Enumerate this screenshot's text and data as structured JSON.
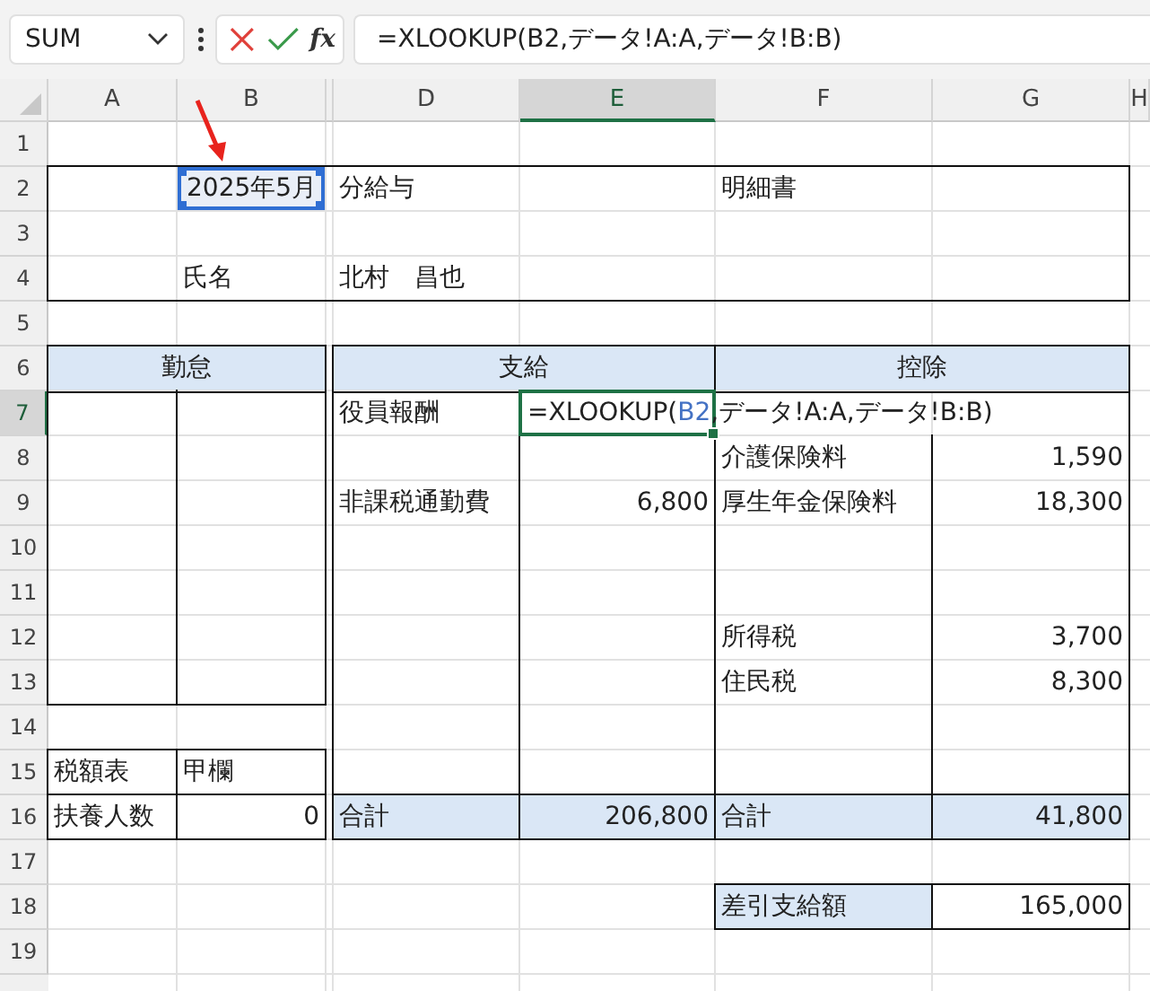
{
  "name_box": {
    "value": "SUM"
  },
  "formula_bar": {
    "function_label": "fx",
    "value": "=XLOOKUP(B2,データ!A:A,データ!B:B)"
  },
  "columns": [
    {
      "label": "A",
      "selected": false
    },
    {
      "label": "B",
      "selected": false
    },
    {
      "selected": false
    },
    {
      "label": "D",
      "selected": false
    },
    {
      "label": "E",
      "selected": true
    },
    {
      "label": "F",
      "selected": false
    },
    {
      "label": "G",
      "selected": false
    },
    {
      "label": "H",
      "selected": false
    }
  ],
  "rows": [
    {
      "label": "1",
      "selected": false
    },
    {
      "label": "2",
      "selected": false,
      "cells": [
        {},
        {
          "kind": "number",
          "text": "2025年5月",
          "selected": true
        },
        {},
        {
          "kind": "text",
          "text": "分給与"
        },
        {},
        {
          "kind": "text",
          "text": "明細書"
        }
      ]
    },
    {
      "label": "3",
      "selected": false
    },
    {
      "label": "4",
      "selected": false,
      "cells": [
        {},
        {
          "kind": "text",
          "text": "氏名"
        },
        {},
        {
          "kind": "text",
          "text": "北村　昌也"
        }
      ]
    },
    {
      "label": "5",
      "selected": false
    },
    {
      "label": "6",
      "selected": false,
      "cells": [
        {
          "kind": "header",
          "text": "勤怠",
          "filled": true
        },
        {},
        {},
        {
          "kind": "header",
          "text": "支給",
          "filled": true
        },
        {},
        {
          "kind": "header",
          "text": "控除",
          "filled": true
        }
      ]
    },
    {
      "label": "7",
      "selected": true,
      "cells": [
        {},
        {},
        {},
        {
          "kind": "text",
          "text": "役員報酬"
        },
        {
          "kind": "formula",
          "editing": true,
          "parts": [
            {
              "kind": "plain",
              "text": "=XLOOKUP("
            },
            {
              "kind": "reference",
              "text": "B2"
            },
            {
              "kind": "plain",
              "text": ",データ!A:A,データ!B:B)"
            }
          ]
        }
      ]
    },
    {
      "label": "8",
      "selected": false,
      "cells": [
        {},
        {},
        {},
        {},
        {},
        {
          "kind": "text",
          "text": "介護保険料"
        },
        {
          "kind": "number",
          "text": "1,590"
        }
      ]
    },
    {
      "label": "9",
      "selected": false,
      "cells": [
        {},
        {},
        {},
        {
          "kind": "text",
          "text": "非課税通勤費"
        },
        {
          "kind": "number",
          "text": "6,800"
        },
        {
          "kind": "text",
          "text": "厚生年金保険料"
        },
        {
          "kind": "number",
          "text": "18,300"
        }
      ]
    },
    {
      "label": "10",
      "selected": false
    },
    {
      "label": "11",
      "selected": false
    },
    {
      "label": "12",
      "selected": false,
      "cells": [
        {},
        {},
        {},
        {},
        {},
        {
          "kind": "text",
          "text": "所得税"
        },
        {
          "kind": "number",
          "text": "3,700"
        }
      ]
    },
    {
      "label": "13",
      "selected": false,
      "cells": [
        {},
        {},
        {},
        {},
        {},
        {
          "kind": "text",
          "text": "住民税"
        },
        {
          "kind": "number",
          "text": "8,300"
        }
      ]
    },
    {
      "label": "14",
      "selected": false
    },
    {
      "label": "15",
      "selected": false,
      "cells": [
        {
          "kind": "text",
          "text": "税額表"
        },
        {
          "kind": "text",
          "text": "甲欄"
        }
      ]
    },
    {
      "label": "16",
      "selected": false,
      "cells": [
        {
          "kind": "text",
          "text": "扶養人数"
        },
        {
          "kind": "number",
          "text": "0"
        },
        {},
        {
          "kind": "text",
          "text": "合計",
          "filled": true
        },
        {
          "kind": "number",
          "text": "206,800",
          "filled": true
        },
        {
          "kind": "text",
          "text": "合計",
          "filled": true
        },
        {
          "kind": "number",
          "text": "41,800",
          "filled": true
        }
      ]
    },
    {
      "label": "17",
      "selected": false
    },
    {
      "label": "18",
      "selected": false,
      "cells": [
        {},
        {},
        {},
        {},
        {},
        {
          "kind": "text",
          "text": "差引支給額",
          "filled": true
        },
        {
          "kind": "number",
          "text": "165,000"
        }
      ]
    },
    {
      "label": "19",
      "selected": false
    }
  ]
}
